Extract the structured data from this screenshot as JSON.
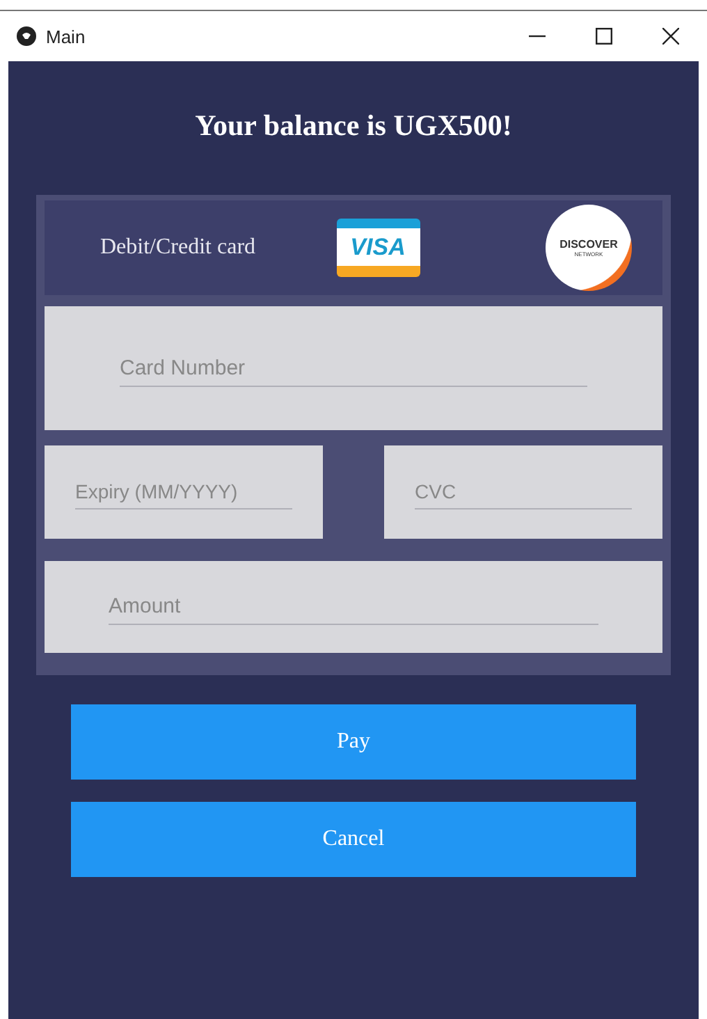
{
  "window": {
    "title": "Main"
  },
  "heading": "Your balance is UGX500!",
  "card_header": {
    "label": "Debit/Credit card",
    "visa_logo": "VISA",
    "discover_logo": {
      "name": "DISCOVER",
      "sub": "NETWORK"
    }
  },
  "card_number": {
    "placeholder": "Card Number"
  },
  "expiry": {
    "placeholder": "Expiry (MM/YYYY)"
  },
  "cvc": {
    "placeholder": "CVC"
  },
  "amount": {
    "placeholder": "Amount"
  },
  "buttons": [
    "Pay",
    "Cancel"
  ]
}
